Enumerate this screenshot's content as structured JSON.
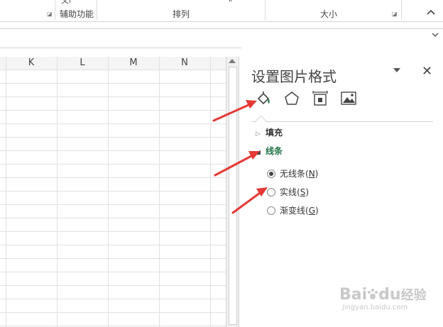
{
  "ribbon": {
    "accessibility_label": "辅助功能",
    "arrange_label": "排列",
    "size_label": "大小",
    "collapse_icon": "chevron-up-icon"
  },
  "grid": {
    "columns": [
      "K",
      "L",
      "M",
      "N"
    ]
  },
  "pane": {
    "title": "设置图片格式",
    "tabs": [
      "fill-line-icon",
      "effects-pentagon-icon",
      "size-properties-icon",
      "picture-icon"
    ],
    "sections": {
      "fill": {
        "label": "填充",
        "expanded": false
      },
      "line": {
        "label": "线条",
        "expanded": true
      }
    },
    "line_options": [
      {
        "label": "无线条(",
        "key": "N",
        "suffix": ")",
        "selected": true
      },
      {
        "label": "实线(",
        "key": "S",
        "suffix": ")",
        "selected": false
      },
      {
        "label": "渐变线(",
        "key": "G",
        "suffix": ")",
        "selected": false
      }
    ]
  },
  "colors": {
    "accent_green": "#217346",
    "arrow_red": "#e53935"
  },
  "watermark": {
    "brand": "Bai",
    "brand2": "du",
    "cn": "经验",
    "url": "jingyan.baidu.com"
  }
}
